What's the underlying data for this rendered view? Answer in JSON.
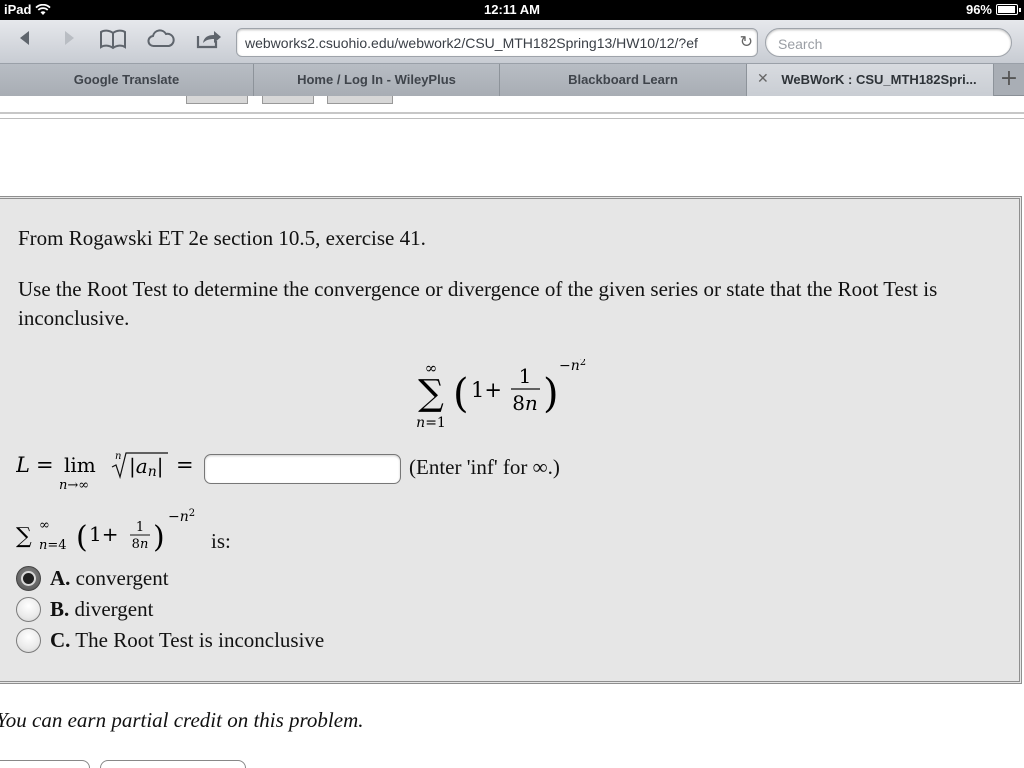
{
  "status_bar": {
    "device": "iPad",
    "time": "12:11 AM",
    "battery": "96%",
    "battery_level": 0.96
  },
  "browser": {
    "url": "webworks2.csuohio.edu/webwork2/CSU_MTH182Spring13/HW10/12/?ef",
    "search_placeholder": "Search",
    "tabs": [
      {
        "label": "Google Translate",
        "active": false
      },
      {
        "label": "Home / Log In - WileyPlus",
        "active": false
      },
      {
        "label": "Blackboard Learn",
        "active": false
      },
      {
        "label": "WeBWorK : CSU_MTH182Spri...",
        "active": true
      }
    ]
  },
  "problem": {
    "source": "From Rogawski ET 2e section 10.5, exercise 41.",
    "instruction": "Use the Root Test to determine the convergence or divergence of the given series or state that the Root Test is inconclusive.",
    "limit_hint": "(Enter 'inf' for ∞.)",
    "answer_value": "",
    "series_prompt": "is:",
    "options": [
      {
        "letter": "A.",
        "text": "convergent",
        "selected": true
      },
      {
        "letter": "B.",
        "text": "divergent",
        "selected": false
      },
      {
        "letter": "C.",
        "text": "The Root Test is inconclusive",
        "selected": false
      }
    ]
  },
  "footer": {
    "credit_note": "You can earn partial credit on this problem."
  }
}
